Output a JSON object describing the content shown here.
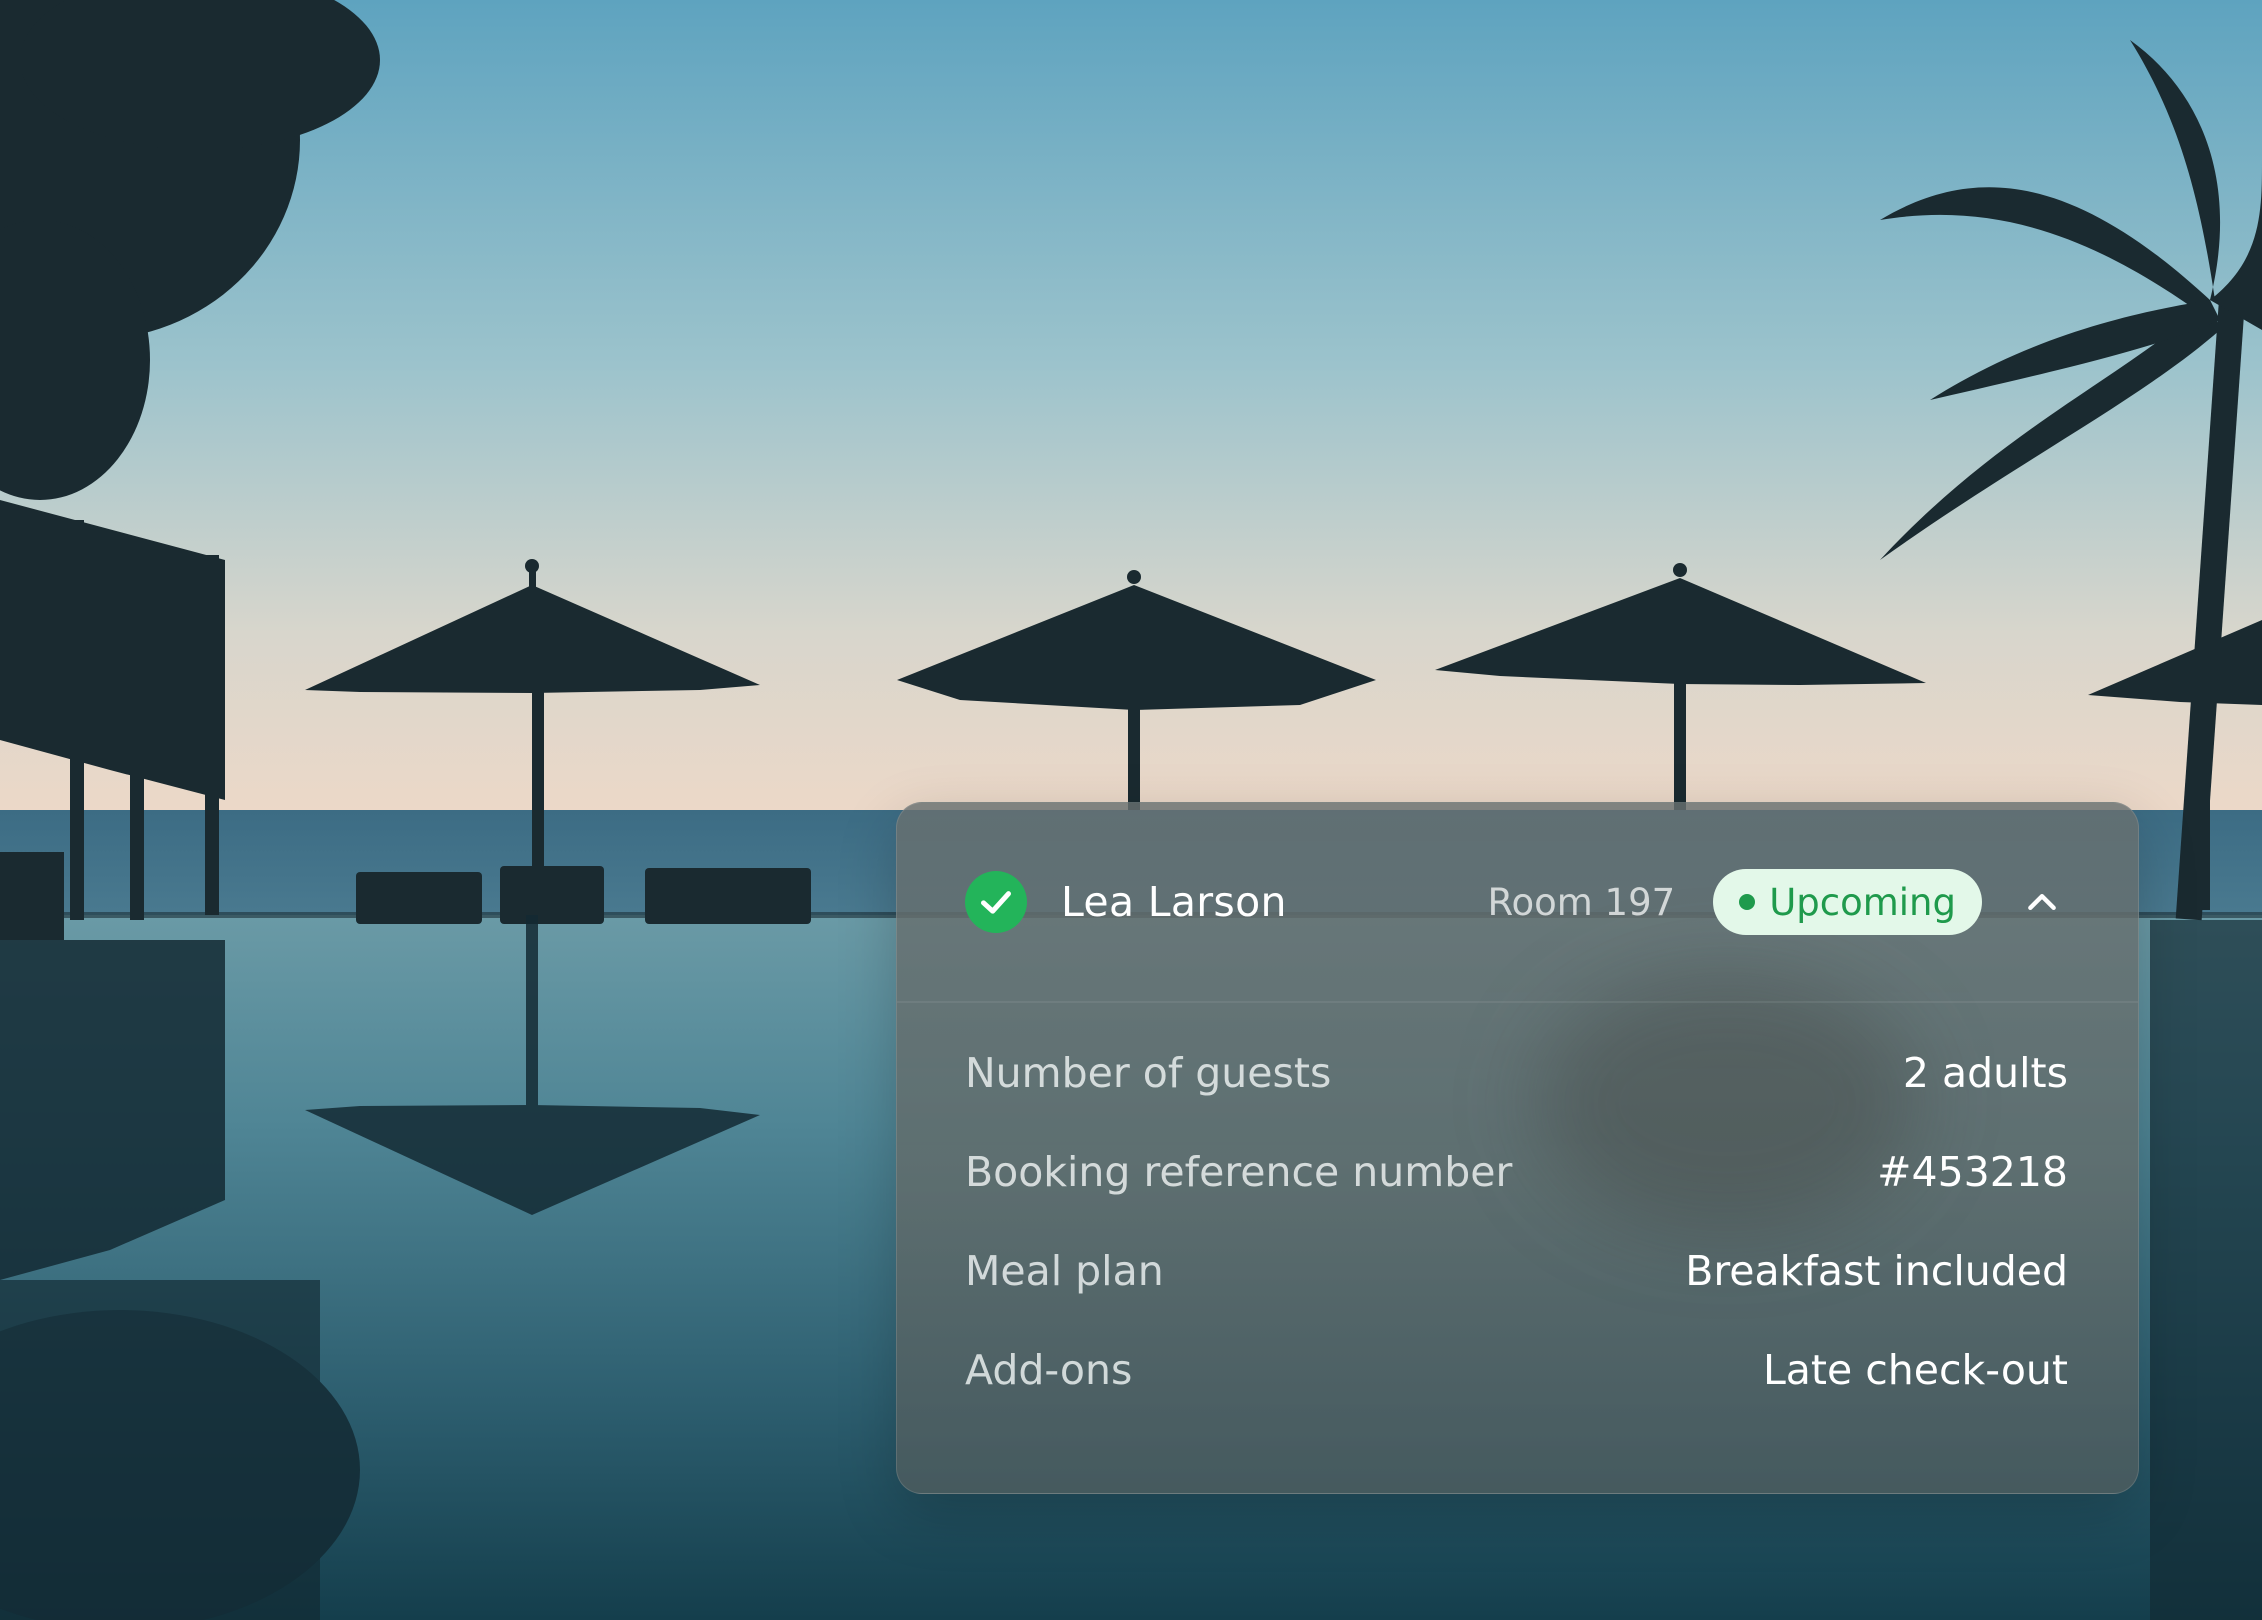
{
  "booking_card": {
    "guest_name": "Lea Larson",
    "room": "Room 197",
    "status": "Upcoming",
    "status_color": "#1f9a4c",
    "status_bg": "#e3f8e9",
    "verified_color": "#23b45a",
    "expanded": true,
    "details": [
      {
        "label": "Number of guests",
        "value": "2 adults"
      },
      {
        "label": "Booking reference number",
        "value": "#453218"
      },
      {
        "label": "Meal plan",
        "value": "Breakfast included"
      },
      {
        "label": "Add-ons",
        "value": "Late check-out"
      }
    ]
  },
  "icons": {
    "verified": "check-circle-icon",
    "collapse": "chevron-up-icon"
  }
}
